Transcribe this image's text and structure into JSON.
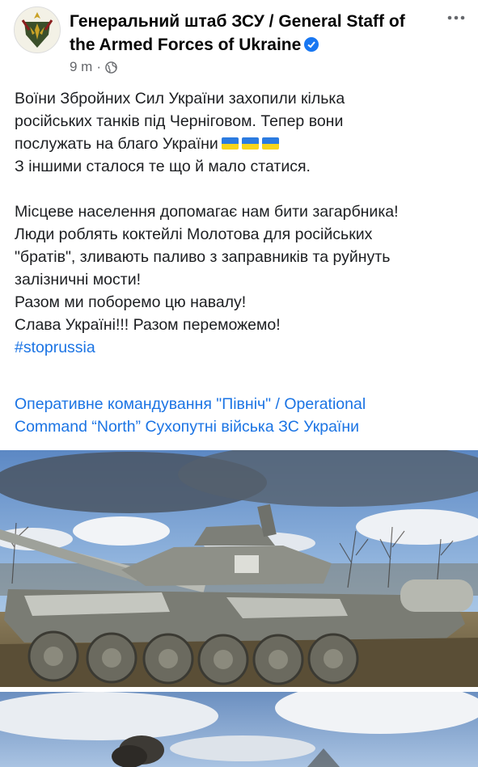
{
  "post": {
    "page_name": "Генеральний штаб ЗСУ / General Staff of the Armed Forces of Ukraine",
    "time": "9 m",
    "separator": "·",
    "lines": [
      "Воїни Збройних Сил України захопили кілька",
      "російських танків під Черніговом. Тепер вони",
      "послужать на благо України",
      "З іншими сталося те що й мало статися.",
      "",
      "Місцеве населення допомагає нам бити загарбника!",
      "Люди роблять коктейлі Молотова для російських",
      "\"братів\", зливають паливо з заправників та руйнуть",
      "залізничні мости!",
      "Разом ми поборемо цю навалу!",
      "Слава Україні!!! Разом переможемо!"
    ],
    "hashtag": "#stoprussia",
    "mention_line1": "Оперативне командування \"Північ\" / Operational",
    "mention_line2": "Command “North” Сухопутні війська ЗС України"
  },
  "icons": {
    "privacy": "globe-icon",
    "more": "more-horizontal-icon",
    "verified": "verified-badge-icon",
    "flag": "ukraine-flag-icon"
  },
  "colors": {
    "link": "#1b74e4",
    "verified": "#1877f2",
    "flag_blue": "#2c7be0",
    "flag_yellow": "#f7d51b"
  }
}
